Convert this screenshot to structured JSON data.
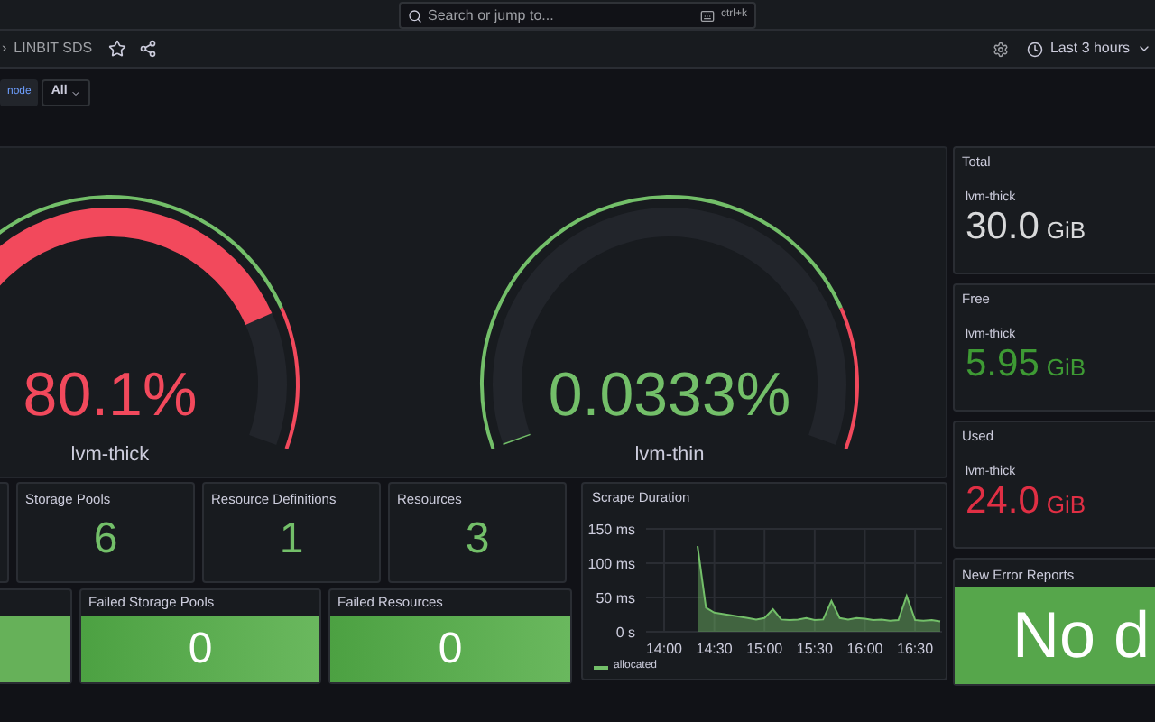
{
  "search": {
    "placeholder": "Search or jump to...",
    "shortcut": "ctrl+k"
  },
  "breadcrumb": {
    "separator": "›",
    "title": "LINBIT SDS"
  },
  "time_picker": {
    "label": "Last 3 hours"
  },
  "variables": [
    {
      "name": "node",
      "value": "All"
    }
  ],
  "gauges": [
    {
      "value": "80.1%",
      "label": "lvm-thick",
      "color": "#f2495c"
    },
    {
      "value": "0.0333%",
      "label": "lvm-thin",
      "color": "#73bf69"
    }
  ],
  "stats": [
    {
      "title": "Storage Pools",
      "value": "6"
    },
    {
      "title": "Resource Definitions",
      "value": "1"
    },
    {
      "title": "Resources",
      "value": "3"
    }
  ],
  "failed": [
    {
      "title": "Failed Storage Pools",
      "value": "0"
    },
    {
      "title": "Failed Resources",
      "value": "0"
    }
  ],
  "scrape": {
    "title": "Scrape Duration",
    "chart_data": {
      "type": "area",
      "categories": [
        "14:00",
        null,
        null,
        null,
        null,
        null,
        "14:30",
        null,
        null,
        null,
        null,
        null,
        "15:00",
        null,
        null,
        null,
        null,
        null,
        "15:30",
        null,
        null,
        null,
        null,
        null,
        "16:00",
        null,
        null,
        null,
        null,
        null,
        "16:30",
        null,
        null,
        null
      ],
      "series": [
        {
          "name": "allocated",
          "color": "#73bf69",
          "values": [
            null,
            null,
            null,
            null,
            125,
            35,
            28,
            26,
            24,
            22,
            20,
            18,
            20,
            33,
            18,
            17,
            18,
            20,
            17,
            18,
            45,
            20,
            18,
            20,
            19,
            17,
            18,
            16,
            17,
            52,
            17,
            16,
            17,
            15
          ]
        }
      ],
      "ylim": [
        0,
        150
      ],
      "grid": true,
      "yticks": [
        {
          "value": 0,
          "label": "0 s"
        },
        {
          "value": 50,
          "label": "50 ms"
        },
        {
          "value": 100,
          "label": "100 ms"
        },
        {
          "value": 150,
          "label": "150 ms"
        }
      ]
    }
  },
  "capacity": [
    {
      "title": "Total",
      "label": "lvm-thick",
      "value": "30.0",
      "unit": "GiB",
      "color": "#d8d9da"
    },
    {
      "title": "Free",
      "label": "lvm-thick",
      "value": "5.95",
      "unit": "GiB",
      "color": "#3e9a34"
    },
    {
      "title": "Used",
      "label": "lvm-thick",
      "value": "24.0",
      "unit": "GiB",
      "color": "#e02f44"
    }
  ],
  "error_reports": {
    "title": "New Error Reports",
    "value": "No d"
  }
}
